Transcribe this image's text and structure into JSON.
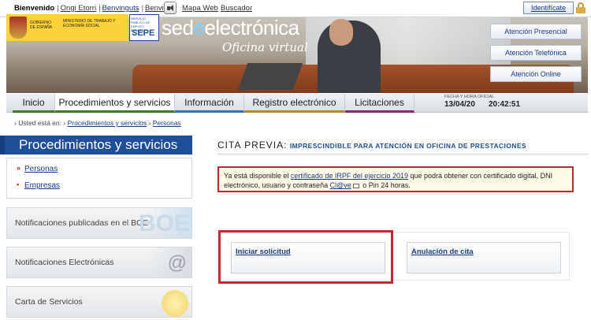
{
  "langbar": {
    "welcome": "Bienvenido",
    "basque": "Ongi Etorri",
    "catalan": "Benvinguts",
    "galician": "Benvido",
    "sitemap": "Mapa Web",
    "finder": "Buscador",
    "identify": "Identifícate"
  },
  "header": {
    "gov_text": "GOBIERNO DE ESPAÑA",
    "ministry_text": "MINISTERIO DE TRABAJO Y ECONOMÍA SOCIAL",
    "sepe_top": "SERVICIO PÚBLICO DE EMPLEO ESTATAL",
    "sepe": "SEPE",
    "title_pre": "sed",
    "title_dot": "e",
    "title_post": "electrónica",
    "subtitle": "Oficina virtual",
    "attention_buttons": [
      "Atención Presencial",
      "Atención Telefónica",
      "Atención Online"
    ]
  },
  "nav": {
    "tabs": [
      "Inicio",
      "Procedimientos y servicios",
      "Información",
      "Registro electrónico",
      "Licitaciones"
    ],
    "datetime_label": "FECHA Y HORA OFICIAL",
    "date": "13/04/20",
    "time": "20:42:51"
  },
  "breadcrumb": {
    "prefix": "› Usted está en: ›",
    "items": [
      "Procedimientos y servicios",
      "Personas"
    ],
    "separator": "›"
  },
  "sidebar": {
    "title": "Procedimientos y servicios",
    "links": [
      "Personas",
      "Empresas"
    ],
    "boxes": [
      "Notificaciones publicadas en el BOE",
      "Notificaciones Electrónicas",
      "Carta de Servicios"
    ]
  },
  "main": {
    "heading_lead": "CITA PREVIA:",
    "heading_sub": "Imprescindible para atención en oficina de prestaciones",
    "notice": {
      "part1": "Ya está disponible el ",
      "link1": "certificado de IRPF del ejercicio 2019",
      "part2": " que podrá obtener con certificado digital, DNI electrónico, usuario y contraseña ",
      "link2": "Cl@ve",
      "part3": " o Pin 24 horas."
    },
    "actions": [
      "Iniciar solicitud",
      "Anulación de cita"
    ]
  },
  "colors": {
    "brand_blue": "#1f4f9a",
    "highlight_red": "#c9252e",
    "gov_yellow": "#fcd23b"
  }
}
